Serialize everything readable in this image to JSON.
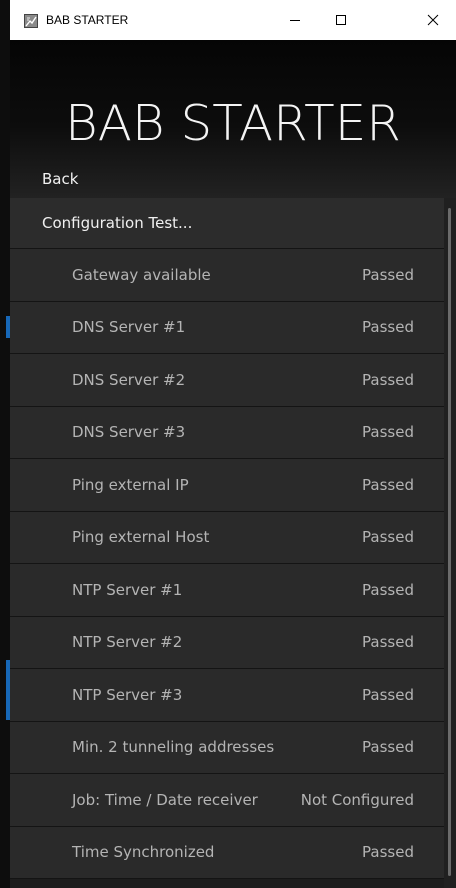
{
  "window": {
    "title": "BAB STARTER",
    "icon": "app-logo-icon",
    "minimize_icon": "minimize-icon",
    "maximize_icon": "maximize-icon",
    "close_icon": "close-icon"
  },
  "header": {
    "app_title": "BAB STARTER",
    "back_label": "Back"
  },
  "section": {
    "title": "Configuration Test..."
  },
  "tests": [
    {
      "label": "Gateway available",
      "status": "Passed"
    },
    {
      "label": "DNS Server #1",
      "status": "Passed"
    },
    {
      "label": "DNS Server #2",
      "status": "Passed"
    },
    {
      "label": "DNS Server #3",
      "status": "Passed"
    },
    {
      "label": "Ping external IP",
      "status": "Passed"
    },
    {
      "label": "Ping external Host",
      "status": "Passed"
    },
    {
      "label": "NTP Server #1",
      "status": "Passed"
    },
    {
      "label": "NTP Server #2",
      "status": "Passed"
    },
    {
      "label": "NTP Server #3",
      "status": "Passed"
    },
    {
      "label": "Min. 2 tunneling addresses",
      "status": "Passed"
    },
    {
      "label": "Job: Time / Date receiver",
      "status": "Not Configured"
    },
    {
      "label": "Time Synchronized",
      "status": "Passed"
    }
  ],
  "colors": {
    "background": "#1d1d1d",
    "row_background": "#2a2a2a",
    "row_text": "#b4b4b4",
    "accent": "#1768b8"
  }
}
